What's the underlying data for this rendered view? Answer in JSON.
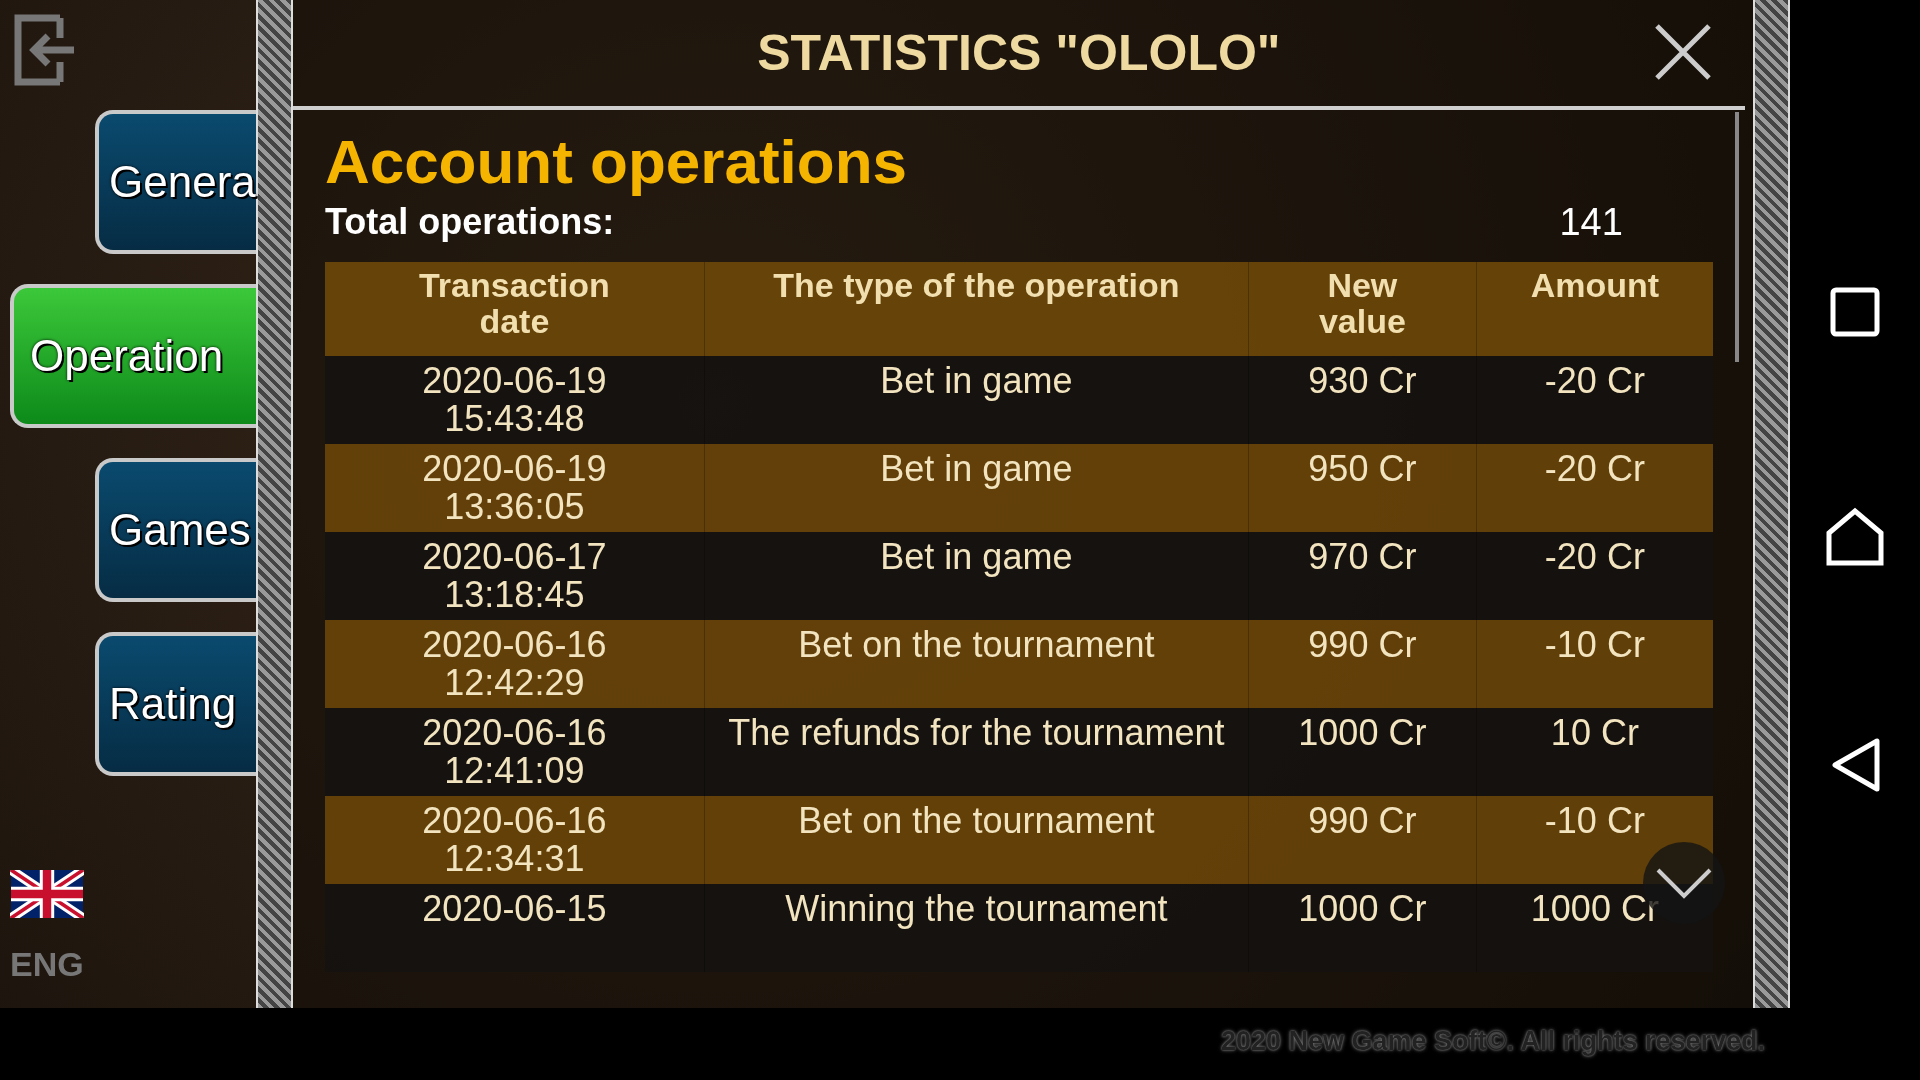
{
  "title": "STATISTICS \"OLOLO\"",
  "nav": [
    {
      "label": "Genera",
      "selected": false
    },
    {
      "label": "Operation",
      "selected": true
    },
    {
      "label": "Games",
      "selected": false
    },
    {
      "label": "Rating",
      "selected": false
    }
  ],
  "language": "ENG",
  "section": {
    "heading": "Account operations",
    "total_label": "Total operations:",
    "total_value": "141"
  },
  "table": {
    "columns": [
      "Transaction date",
      "The type of the operation",
      "New value",
      "Amount"
    ],
    "rows": [
      [
        "2020-06-19 15:43:48",
        "Bet in game",
        "930 Cr",
        "-20 Cr"
      ],
      [
        "2020-06-19 13:36:05",
        "Bet in game",
        "950 Cr",
        "-20 Cr"
      ],
      [
        "2020-06-17 13:18:45",
        "Bet in game",
        "970 Cr",
        "-20 Cr"
      ],
      [
        "2020-06-16 12:42:29",
        "Bet on the tournament",
        "990 Cr",
        "-10 Cr"
      ],
      [
        "2020-06-16 12:41:09",
        "The refunds for the tournament",
        "1000 Cr",
        "10 Cr"
      ],
      [
        "2020-06-16 12:34:31",
        "Bet on the tournament",
        "990 Cr",
        "-10 Cr"
      ],
      [
        "2020-06-15",
        "Winning the tournament",
        "1000 Cr",
        "1000 Cr"
      ]
    ]
  },
  "footer": "2020 New Game Soft©. All rights reserved."
}
